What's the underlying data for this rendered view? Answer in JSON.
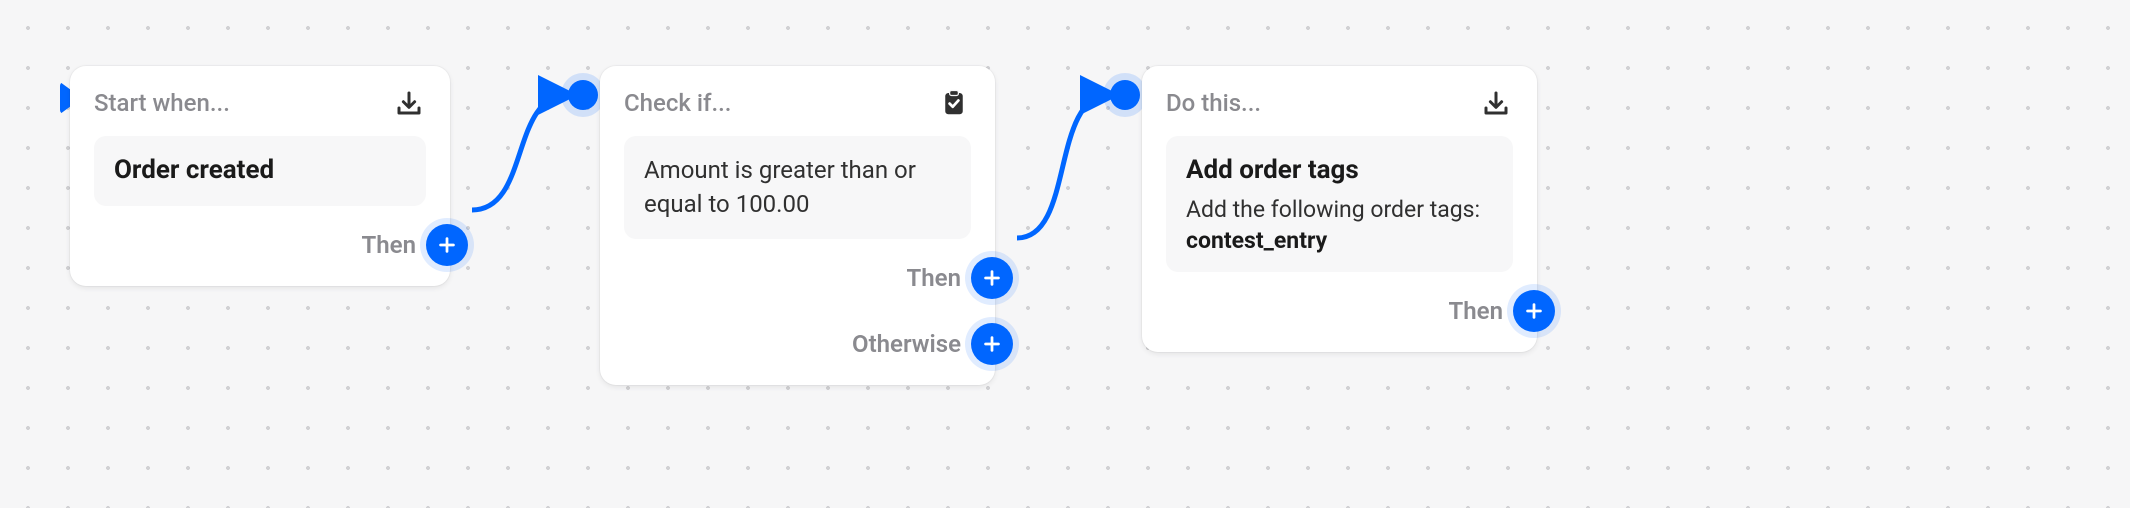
{
  "colors": {
    "accent": "#0066ff",
    "bg": "#f6f6f7"
  },
  "nodes": {
    "start": {
      "header": "Start when...",
      "icon": "download-icon",
      "title": "Order created",
      "ports": {
        "then": "Then"
      }
    },
    "condition": {
      "header": "Check if...",
      "icon": "clipboard-check-icon",
      "body": "Amount is greater than or equal to 100.00",
      "ports": {
        "then": "Then",
        "otherwise": "Otherwise"
      }
    },
    "action": {
      "header": "Do this...",
      "icon": "download-icon",
      "title": "Add order tags",
      "subtitle": "Add the following order tags:",
      "tag": "contest_entry",
      "ports": {
        "then": "Then"
      }
    }
  }
}
